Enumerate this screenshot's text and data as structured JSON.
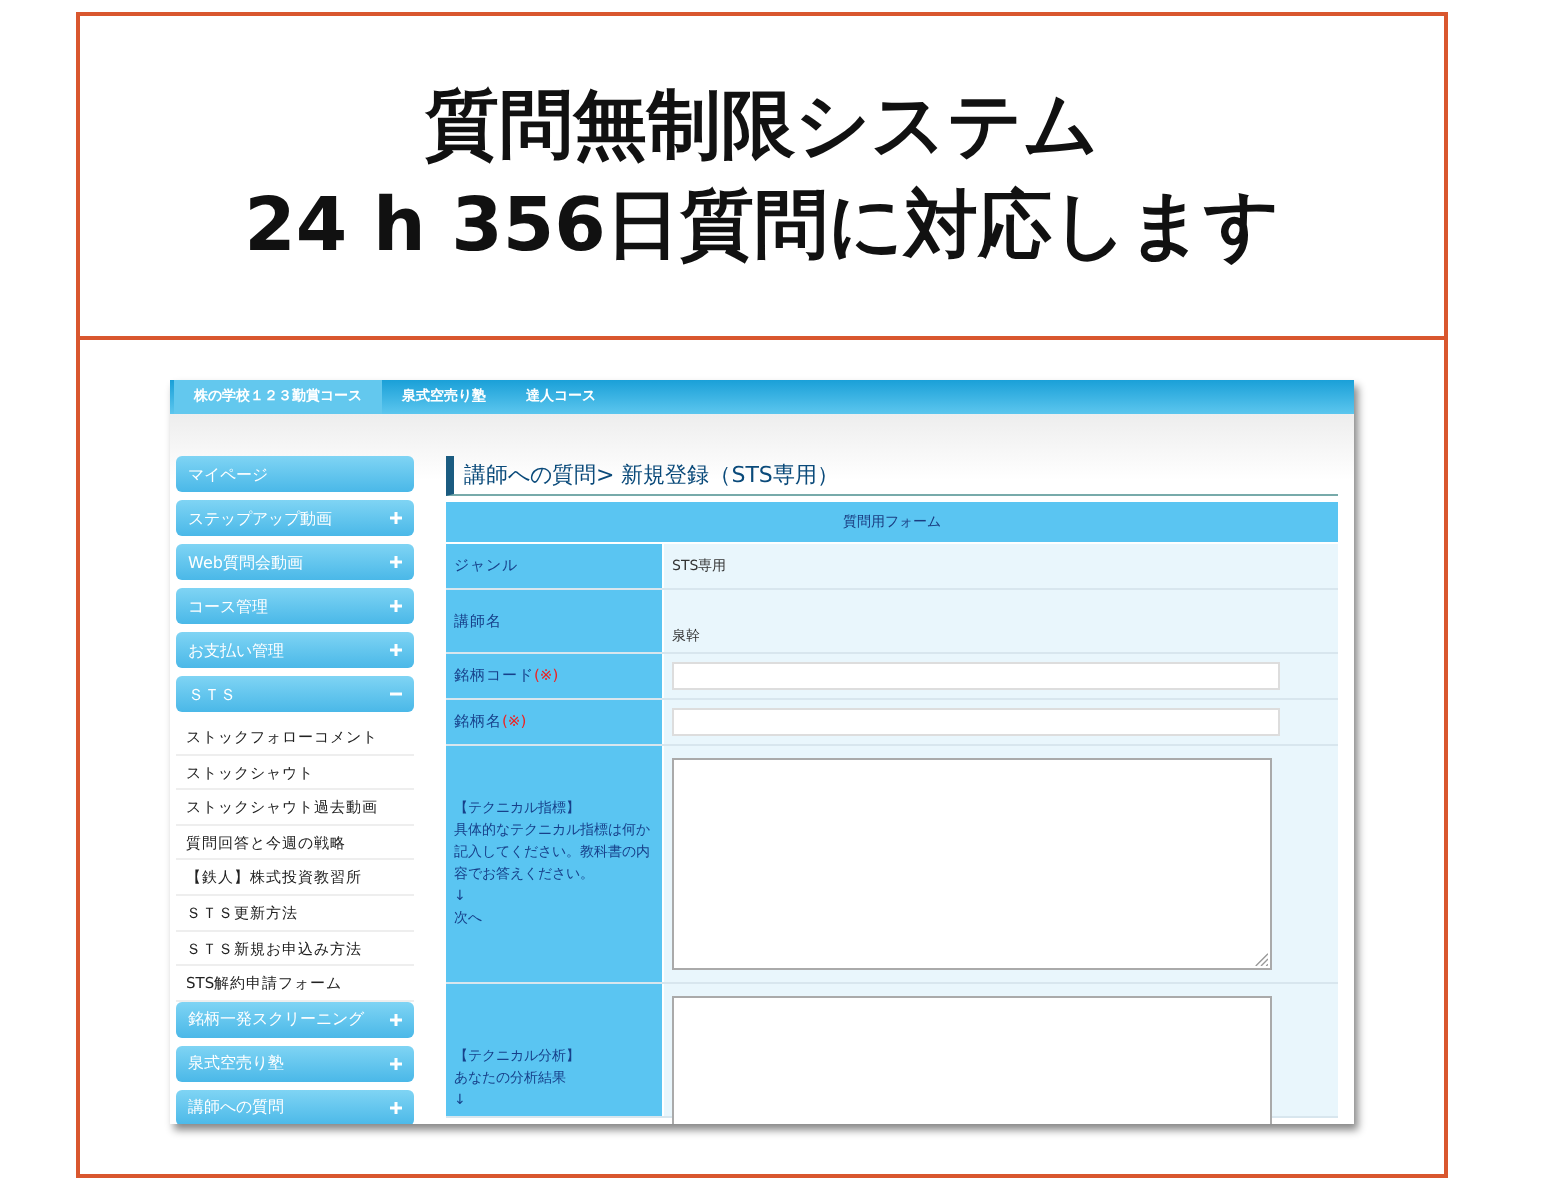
{
  "headline": [
    "質問無制限システム",
    "24 h 356日質問に対応します"
  ],
  "screenshot": {
    "nav_tabs": [
      {
        "label": "株の学校１２３勤賞コース",
        "selected": true
      },
      {
        "label": "泉式空売り塾",
        "selected": false
      },
      {
        "label": "達人コース",
        "selected": false
      }
    ],
    "sidebar": [
      {
        "kind": "page",
        "label": "マイページ"
      },
      {
        "kind": "section",
        "label": "ステップアップ動画",
        "expanded": false
      },
      {
        "kind": "section",
        "label": "Web質問会動画",
        "expanded": false
      },
      {
        "kind": "section",
        "label": "コース管理",
        "expanded": false
      },
      {
        "kind": "section",
        "label": "お支払い管理",
        "expanded": false
      },
      {
        "kind": "section",
        "label": "ＳＴＳ",
        "expanded": true,
        "children": [
          {
            "label": "ストックフォローコメント"
          },
          {
            "label": "ストックシャウト"
          },
          {
            "label": "ストックシャウト過去動画"
          },
          {
            "label": "質問回答と今週の戦略"
          },
          {
            "label": "【鉄人】株式投資教習所"
          },
          {
            "label": "ＳＴＳ更新方法"
          },
          {
            "label": "ＳＴＳ新規お申込み方法"
          },
          {
            "label": "STS解約申請フォーム"
          }
        ]
      },
      {
        "kind": "section",
        "label": "銘柄一発スクリーニング",
        "expanded": false
      },
      {
        "kind": "section",
        "label": "泉式空売り塾",
        "expanded": false
      },
      {
        "kind": "section",
        "label": "講師への質問",
        "expanded": false
      }
    ],
    "page_title": "講師への質問> 新規登録（STS専用）",
    "form": {
      "header": "質問用フォーム",
      "rows": [
        {
          "kind": "text",
          "label": "ジャンル",
          "value": "STS専用"
        },
        {
          "kind": "text",
          "label": "講師名",
          "value": "泉幹"
        },
        {
          "kind": "input",
          "label": "銘柄コード",
          "required_mark": "(※)"
        },
        {
          "kind": "input",
          "label": "銘柄名",
          "required_mark": "(※)"
        },
        {
          "kind": "textarea",
          "label_lines": [
            "【テクニカル指標】",
            "具体的なテクニカル指標は何か記入してください。教科書の内容でお答えください。",
            "↓",
            "次へ"
          ]
        },
        {
          "kind": "textarea",
          "label_lines": [
            "【テクニカル分析】",
            "あなたの分析結果",
            "↓"
          ]
        }
      ]
    }
  }
}
